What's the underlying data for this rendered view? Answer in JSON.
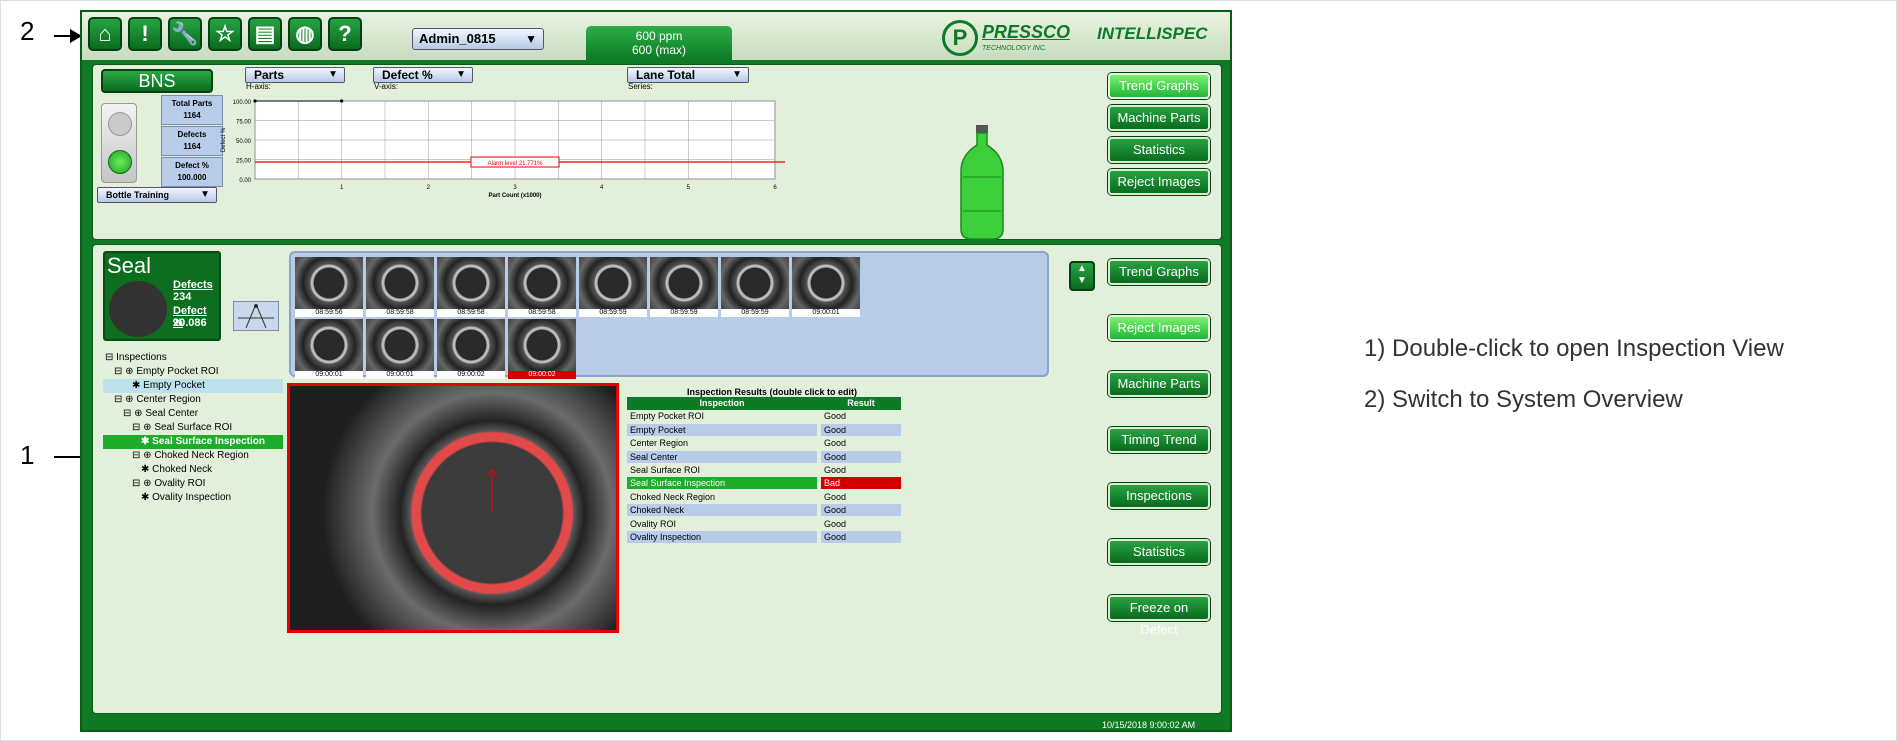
{
  "callouts": {
    "num1": "1",
    "num2": "2"
  },
  "legend": [
    "1) Double-click to open Inspection View",
    "2) Switch to System Overview"
  ],
  "toolbar": {
    "buttons": [
      {
        "name": "home-icon",
        "glyph": "⌂"
      },
      {
        "name": "alert-icon",
        "glyph": "!"
      },
      {
        "name": "wrench-icon",
        "glyph": "🔧"
      },
      {
        "name": "star-icon",
        "glyph": "☆"
      },
      {
        "name": "save-icon",
        "glyph": "▤"
      },
      {
        "name": "globe-icon",
        "glyph": "◍"
      },
      {
        "name": "help-icon",
        "glyph": "?"
      }
    ],
    "user": "Admin_0815",
    "rate_line1": "600 ppm",
    "rate_line2": "600 (max)",
    "brand1": "PRESSCO",
    "brand1_sub": "TECHNOLOGY INC.",
    "brand2": "INTELLISPEC"
  },
  "top_panel": {
    "station": "BNS",
    "stats": [
      {
        "label": "Total Parts",
        "value": "1164"
      },
      {
        "label": "Defects",
        "value": "1164"
      },
      {
        "label": "Defect %",
        "value": "100.000"
      }
    ],
    "mode": "Bottle Training",
    "haxis_select": "Parts",
    "haxis_caption": "H-axis:",
    "vaxis_select": "Defect %",
    "vaxis_caption": "V-axis:",
    "series_select": "Lane Total",
    "series_caption": "Series:",
    "chart_ylabel": "Defect %",
    "chart_xlabel": "Part Count (x1000)",
    "y_ticks": [
      "100.00",
      "75.00",
      "50.00",
      "25.00",
      "0.00"
    ],
    "x_ticks": [
      "1",
      "2",
      "3",
      "4",
      "5",
      "6"
    ],
    "alarm_label": "Alarm level 21.771%",
    "buttons": [
      "Trend Graphs",
      "Machine Parts",
      "Statistics",
      "Reject Images"
    ]
  },
  "chart_data": {
    "type": "line",
    "title": "",
    "xlabel": "Part Count (x1000)",
    "ylabel": "Defect %",
    "ylim": [
      0,
      100
    ],
    "xlim": [
      0,
      6
    ],
    "series": [
      {
        "x": [
          0,
          1
        ],
        "values": [
          100,
          100
        ]
      }
    ],
    "alarm_level": 21.771
  },
  "bottom_panel": {
    "title": "Seal",
    "defects_label": "Defects",
    "defects_value": "234",
    "defect_pct_label": "Defect %",
    "defect_pct_value": "20.086",
    "tree": [
      {
        "label": "⊟ Inspections",
        "indent": 0,
        "style": ""
      },
      {
        "label": "⊟ ⊕ Empty Pocket ROI",
        "indent": 1,
        "style": ""
      },
      {
        "label": "✱ Empty Pocket",
        "indent": 3,
        "style": "sel"
      },
      {
        "label": "⊟ ⊕ Center Region",
        "indent": 1,
        "style": ""
      },
      {
        "label": "⊟ ⊕ Seal Center",
        "indent": 2,
        "style": ""
      },
      {
        "label": "⊟ ⊕ Seal Surface ROI",
        "indent": 3,
        "style": ""
      },
      {
        "label": "✱ Seal Surface Inspection",
        "indent": 4,
        "style": "hl"
      },
      {
        "label": "⊟ ⊕ Choked Neck Region",
        "indent": 3,
        "style": ""
      },
      {
        "label": "✱ Choked Neck",
        "indent": 4,
        "style": ""
      },
      {
        "label": "⊟ ⊕ Ovality ROI",
        "indent": 3,
        "style": ""
      },
      {
        "label": "✱ Ovality Inspection",
        "indent": 4,
        "style": ""
      }
    ],
    "thumbnails": [
      {
        "time": "08:59:56",
        "bad": false
      },
      {
        "time": "08:59:58",
        "bad": false
      },
      {
        "time": "08:59:58",
        "bad": false
      },
      {
        "time": "08:59:58",
        "bad": false
      },
      {
        "time": "08:59:59",
        "bad": false
      },
      {
        "time": "08:59:59",
        "bad": false
      },
      {
        "time": "08:59:59",
        "bad": false
      },
      {
        "time": "09:00:01",
        "bad": false
      },
      {
        "time": "09:00:01",
        "bad": false
      },
      {
        "time": "09:00:01",
        "bad": false
      },
      {
        "time": "09:00:02",
        "bad": false
      },
      {
        "time": "09:00:02",
        "bad": true
      }
    ],
    "results_title": "Inspection Results (double click to edit)",
    "results_headers": [
      "Inspection",
      "Result"
    ],
    "results": [
      {
        "inspection": "Empty Pocket ROI",
        "result": "Good",
        "bad": false
      },
      {
        "inspection": "Empty Pocket",
        "result": "Good",
        "bad": false
      },
      {
        "inspection": "Center Region",
        "result": "Good",
        "bad": false
      },
      {
        "inspection": "Seal Center",
        "result": "Good",
        "bad": false
      },
      {
        "inspection": "Seal Surface ROI",
        "result": "Good",
        "bad": false
      },
      {
        "inspection": "Seal Surface Inspection",
        "result": "Bad",
        "bad": true
      },
      {
        "inspection": "Choked Neck Region",
        "result": "Good",
        "bad": false
      },
      {
        "inspection": "Choked Neck",
        "result": "Good",
        "bad": false
      },
      {
        "inspection": "Ovality ROI",
        "result": "Good",
        "bad": false
      },
      {
        "inspection": "Ovality Inspection",
        "result": "Good",
        "bad": false
      }
    ],
    "buttons": [
      "Trend Graphs",
      "Reject Images",
      "Machine Parts",
      "Timing Trend",
      "Inspections",
      "Statistics",
      "Freeze on Defect"
    ]
  },
  "status": {
    "datetime": "10/15/2018 9:00:02 AM"
  },
  "colors": {
    "app_green": "#0f7a23",
    "panel_bg": "#e2f0db",
    "bad_red": "#d40000",
    "highlight_green": "#1eac2b"
  }
}
